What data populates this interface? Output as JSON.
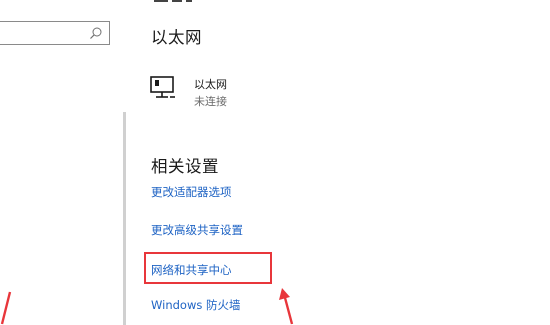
{
  "search": {
    "placeholder": "",
    "icon": "search-icon"
  },
  "ethernet_section": {
    "title": "以太网",
    "item": {
      "icon": "ethernet-monitor-icon",
      "name": "以太网",
      "status": "未连接"
    }
  },
  "related_settings": {
    "title": "相关设置",
    "links": [
      "更改适配器选项",
      "更改高级共享设置",
      "网络和共享中心",
      "Windows 防火墙"
    ],
    "highlighted_index": 2
  },
  "annotations": {
    "highlight_color": "#e8363b",
    "link_color": "#1e63c4"
  }
}
